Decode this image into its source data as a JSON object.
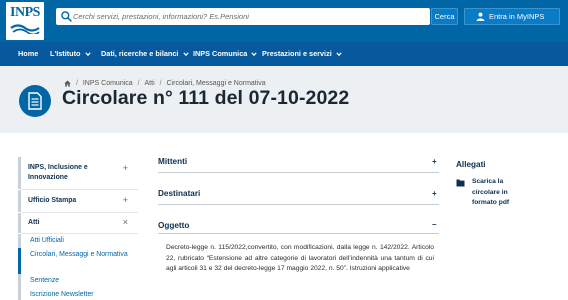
{
  "header": {
    "logo_text": "INPS",
    "search_placeholder": "Cerchi servizi, prestazioni, informazioni? Es.Pensioni",
    "search_button": "Cerca",
    "login_button": "Entra in MyINPS"
  },
  "nav": {
    "items": [
      {
        "label": "Home"
      },
      {
        "label": "L'Istituto"
      },
      {
        "label": "Dati, ricerche e bilanci"
      },
      {
        "label": "INPS Comunica"
      },
      {
        "label": "Prestazioni e servizi"
      }
    ]
  },
  "breadcrumb": [
    "INPS Comunica",
    "Atti",
    "Circolari, Messaggi e Normativa"
  ],
  "page_title": "Circolare n° 111 del 07-10-2022",
  "sidebar": {
    "items": [
      {
        "label": "INPS, Inclusione e Innovazione",
        "sign": "+"
      },
      {
        "label": "Ufficio Stampa",
        "sign": "+"
      },
      {
        "label": "Atti",
        "sign": "×"
      }
    ],
    "subitems": [
      {
        "label": "Atti Ufficiali"
      },
      {
        "label": "Circolari, Messaggi e Normativa"
      },
      {
        "label": "Sentenze"
      },
      {
        "label": "Iscrizione Newsletter"
      }
    ]
  },
  "sections": [
    {
      "title": "Mittenti",
      "sign": "+"
    },
    {
      "title": "Destinatari",
      "sign": "+"
    },
    {
      "title": "Oggetto",
      "sign": "–"
    }
  ],
  "oggetto_text": "Decreto-legge n. 115/2022,convertito, con modificazioni, dalla legge n. 142/2022. Articolo 22, rubricato “Estensione ad altre categorie di lavoratori dell’indennità una tantum di cui agli articoli 31 e 32 del decreto-legge 17 maggio 2022, n. 50”. Istruzioni applicative",
  "allegati": {
    "title": "Allegati",
    "link": "Scarica la circolare in formato pdf"
  },
  "colors": {
    "primary": "#0066a6",
    "nav": "#07599d",
    "band": "#edf0f3",
    "heading": "#0d3050"
  }
}
